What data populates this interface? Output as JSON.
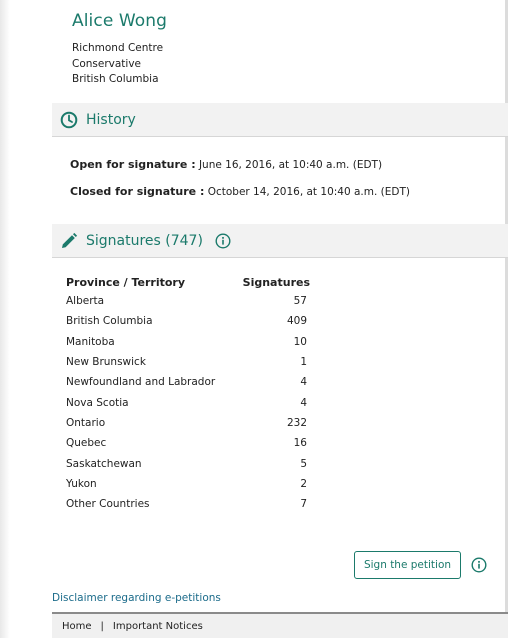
{
  "mp": {
    "name": "Alice Wong",
    "riding": "Richmond Centre",
    "party": "Conservative",
    "province": "British Columbia"
  },
  "history": {
    "title": "History",
    "open_label": "Open for signature :",
    "open_value": "June 16, 2016, at 10:40 a.m. (EDT)",
    "closed_label": "Closed for signature :",
    "closed_value": "October 14, 2016, at 10:40 a.m. (EDT)"
  },
  "signatures": {
    "title": "Signatures (747)",
    "col_province": "Province / Territory",
    "col_signatures": "Signatures",
    "rows": [
      {
        "province": "Alberta",
        "count": "57"
      },
      {
        "province": "British Columbia",
        "count": "409"
      },
      {
        "province": "Manitoba",
        "count": "10"
      },
      {
        "province": "New Brunswick",
        "count": "1"
      },
      {
        "province": "Newfoundland and Labrador",
        "count": "4"
      },
      {
        "province": "Nova Scotia",
        "count": "4"
      },
      {
        "province": "Ontario",
        "count": "232"
      },
      {
        "province": "Quebec",
        "count": "16"
      },
      {
        "province": "Saskatchewan",
        "count": "5"
      },
      {
        "province": "Yukon",
        "count": "2"
      },
      {
        "province": "Other Countries",
        "count": "7"
      }
    ]
  },
  "actions": {
    "sign_label": "Sign the petition"
  },
  "links": {
    "disclaimer": "Disclaimer regarding e-petitions"
  },
  "footer": {
    "home": "Home",
    "separator": "|",
    "notices": "Important Notices"
  },
  "colors": {
    "accent": "#1b7a6b",
    "link": "#1b6b8a",
    "bar_background": "#f2f2f2"
  },
  "icons": {
    "history": "clock-icon",
    "signatures": "pencil-icon",
    "info": "info-icon"
  }
}
